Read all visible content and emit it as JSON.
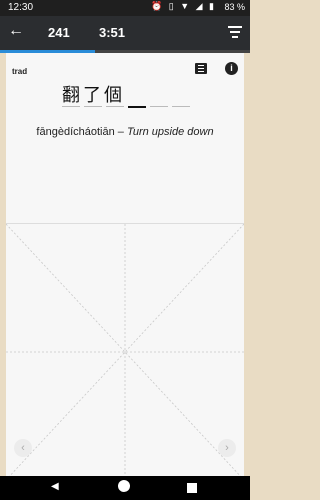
{
  "status": {
    "time": "12:30",
    "icons": "⏰ ▯ ▼ ◢ ▮",
    "battery": "83 %"
  },
  "app": {
    "back_icon": "arrow-left-icon",
    "count": "241",
    "timer": "3:51",
    "filter_icon": "filter-icon",
    "progress_percent": 38
  },
  "card": {
    "tag": "trad",
    "characters": "翻了個",
    "slots_total": 6,
    "active_slot_index": 3,
    "pinyin": "fāngèdícháotiān",
    "separator": " – ",
    "definition": "Turn upside down",
    "left_nav_icon": "chevron-left-icon",
    "right_nav_icon": "chevron-right-icon"
  },
  "colors": {
    "accent": "#2a8cd8",
    "card_bg": "#f7f7f7",
    "frame_bg": "#e9dcc4"
  }
}
